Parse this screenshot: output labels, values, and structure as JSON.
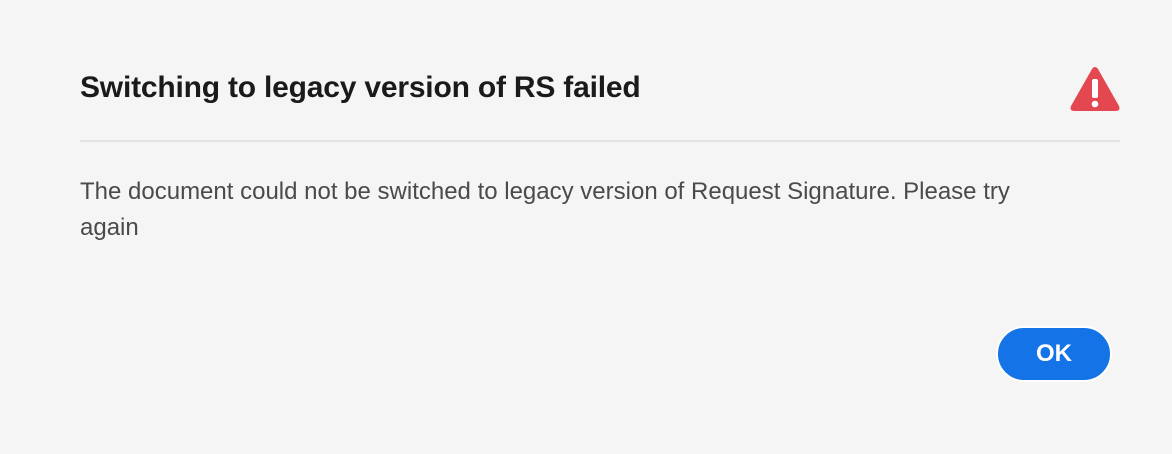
{
  "dialog": {
    "title": "Switching to legacy version of RS failed",
    "icon": "alert-icon",
    "message": "The document could not be switched to legacy version of Request Signature. Please try again",
    "ok_label": "OK"
  },
  "colors": {
    "background": "#f5f5f5",
    "alert": "#e34850",
    "primary_button": "#1473e6"
  }
}
